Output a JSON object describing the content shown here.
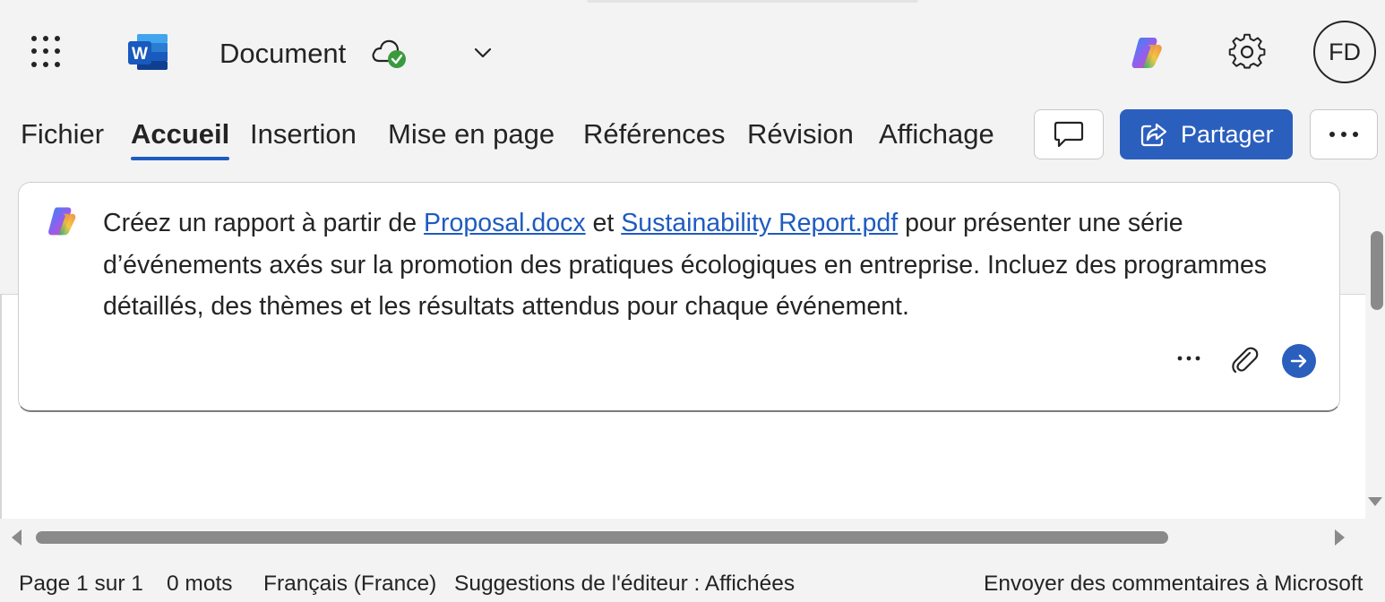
{
  "app": {
    "title": "Document",
    "avatar_initials": "FD"
  },
  "icons": {
    "waffle": "app-launcher-icon",
    "word": "word-logo-icon",
    "cloud": "cloud-saved-icon",
    "chevron": "chevron-down-icon",
    "copilot": "copilot-icon",
    "settings": "gear-icon",
    "comment": "comment-icon",
    "share": "share-icon",
    "more": "more-icon",
    "attach": "paperclip-icon",
    "send": "send-arrow-icon"
  },
  "ribbon": {
    "tabs": [
      {
        "label": "Fichier",
        "active": false
      },
      {
        "label": "Accueil",
        "active": true
      },
      {
        "label": "Insertion",
        "active": false
      },
      {
        "label": "Mise en page",
        "active": false
      },
      {
        "label": "Références",
        "active": false
      },
      {
        "label": "Révision",
        "active": false
      },
      {
        "label": "Affichage",
        "active": false
      }
    ],
    "share_label": "Partager"
  },
  "prompt": {
    "text_before": "Créez un rapport à partir de ",
    "link1": "Proposal.docx",
    "text_mid": " et ",
    "link2": "Sustainability Report.pdf",
    "text_after": " pour présenter une série d’événements axés sur la promotion des pratiques écologiques en entreprise. Incluez des programmes détaillés, des thèmes et les résultats attendus pour chaque événement."
  },
  "status_bar": {
    "page": "Page 1 sur 1",
    "words": "0 mots",
    "language": "Français (France)",
    "editor": "Suggestions de l'éditeur : Affichées",
    "feedback": "Envoyer des commentaires à Microsoft"
  },
  "colors": {
    "accent": "#2b5fbe",
    "link": "#1f5bc0"
  }
}
